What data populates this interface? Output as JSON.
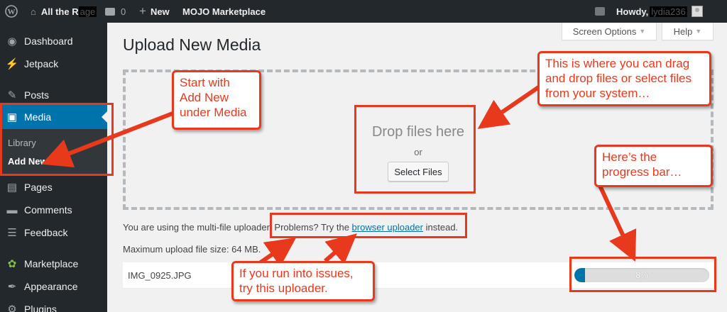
{
  "admin_bar": {
    "wp_logo": "wordpress-icon",
    "site_name_prefix": "All the R",
    "site_name_redacted": "age",
    "comments_count": "0",
    "new_label": "New",
    "marketplace_label": "MOJO Marketplace",
    "howdy_label": "Howdy,",
    "username_redacted": "lydia236"
  },
  "sidebar": {
    "items": [
      {
        "label": "Dashboard",
        "icon": "dashboard-icon"
      },
      {
        "label": "Jetpack",
        "icon": "jetpack-icon"
      },
      {
        "label": "Posts",
        "icon": "pin-icon"
      },
      {
        "label": "Media",
        "icon": "media-icon"
      },
      {
        "label": "Pages",
        "icon": "pages-icon"
      },
      {
        "label": "Comments",
        "icon": "comments-icon"
      },
      {
        "label": "Feedback",
        "icon": "feedback-icon"
      },
      {
        "label": "Marketplace",
        "icon": "marketplace-icon"
      },
      {
        "label": "Appearance",
        "icon": "appearance-icon"
      },
      {
        "label": "Plugins",
        "icon": "plugins-icon"
      }
    ],
    "submenu": {
      "library": "Library",
      "add_new": "Add New"
    }
  },
  "screen_options": {
    "screen_options_label": "Screen Options",
    "help_label": "Help"
  },
  "main": {
    "title": "Upload New Media",
    "drop_text": "Drop files here",
    "or_text": "or",
    "select_files": "Select Files",
    "uploader_prefix": "You are using the multi-file uploader. Problems? Try the",
    "uploader_link": "browser uploader",
    "uploader_suffix": "instead.",
    "max_size": "Maximum upload file size: 64 MB.",
    "file_name": "IMG_0925.JPG",
    "progress_text": "8%",
    "progress_value": 0.08
  },
  "annotations": {
    "media_note": "Start with Add New under Media",
    "drop_note": "This is where you can drag and drop files or select files from your system…",
    "progress_note": "Here’s the progress bar…",
    "uploader_note": "If you run into issues, try this uploader."
  },
  "colors": {
    "admin_bar": "#23282d",
    "active": "#0073aa",
    "annotation": "#e8391d",
    "link": "#0073aa"
  }
}
